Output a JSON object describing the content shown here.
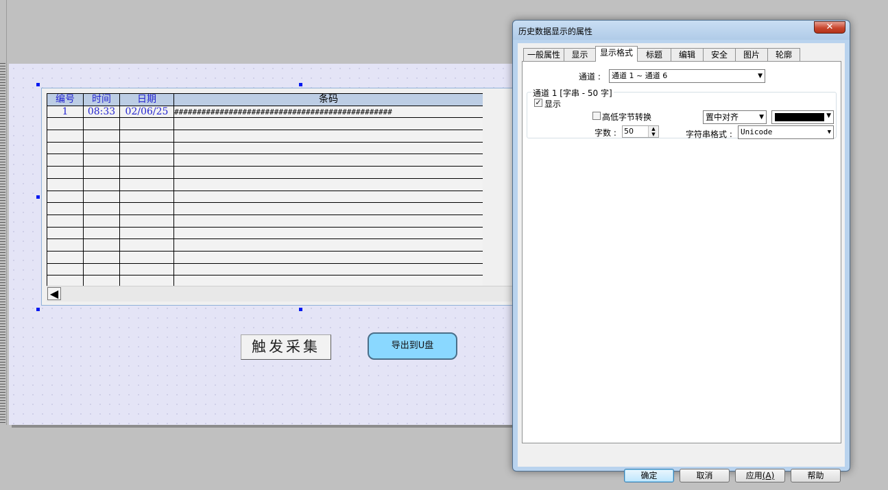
{
  "canvas": {
    "table": {
      "headers": [
        "编号",
        "时间",
        "日期",
        "条码"
      ],
      "rows": [
        [
          "1",
          "08:33",
          "02/06/25",
          "################################################"
        ]
      ],
      "empty_row_count": 14,
      "scroll_left_label": "◀"
    },
    "buttons": {
      "trigger": "触发采集",
      "export": "导出到U盘"
    }
  },
  "dialog": {
    "title": "历史数据显示的属性",
    "close_label": "✕",
    "tabs": [
      {
        "label": "一般属性",
        "active": false
      },
      {
        "label": "显示",
        "active": false
      },
      {
        "label": "显示格式",
        "active": true
      },
      {
        "label": "标题",
        "active": false
      },
      {
        "label": "编辑",
        "active": false
      },
      {
        "label": "安全",
        "active": false
      },
      {
        "label": "图片",
        "active": false
      },
      {
        "label": "轮廓",
        "active": false
      }
    ],
    "panel": {
      "channel_label": "通道 :",
      "channel_value": "通道 1 ~ 通道 6",
      "group_title": "通道 1 [字串 - 50 字]",
      "show_checkbox": {
        "label": "显示",
        "checked": true,
        "mark": "✓"
      },
      "byte_swap_checkbox": {
        "label": "高低字节转换",
        "checked": false
      },
      "align_value": "置中对齐",
      "text_color": "#000000",
      "char_count_label": "字数 :",
      "char_count_value": "50",
      "string_format_label": "字符串格式 :",
      "string_format_value": "Unicode"
    },
    "footer": {
      "ok": "确定",
      "cancel": "取消",
      "apply": "应用",
      "apply_hotkey": "(A)",
      "help": "帮助"
    }
  }
}
